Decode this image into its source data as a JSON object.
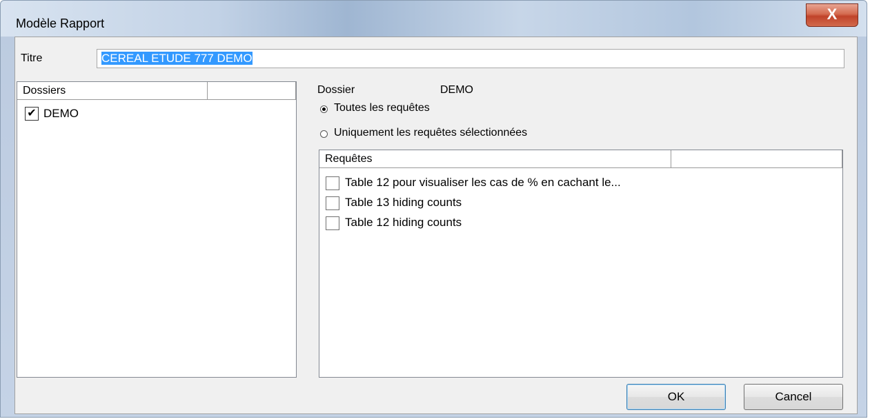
{
  "window": {
    "title": "Modèle Rapport",
    "close_glyph": "X"
  },
  "titre": {
    "label": "Titre",
    "value": "CEREAL ETUDE 777 DEMO"
  },
  "dossiers": {
    "header": "Dossiers",
    "items": [
      {
        "label": "DEMO",
        "checked": true
      }
    ]
  },
  "dossier_info": {
    "label": "Dossier",
    "value": "DEMO"
  },
  "radios": [
    {
      "label": "Toutes les requêtes",
      "checked": true
    },
    {
      "label": "Uniquement les requêtes sélectionnées",
      "checked": false
    }
  ],
  "requetes": {
    "header": "Requêtes",
    "items": [
      {
        "label": "Table 12 pour visualiser les cas de % en cachant le...",
        "checked": false
      },
      {
        "label": "Table 13 hiding counts",
        "checked": false
      },
      {
        "label": "Table 12  hiding counts",
        "checked": false
      }
    ]
  },
  "buttons": {
    "ok": "OK",
    "cancel": "Cancel"
  },
  "icons": {
    "check": "checkmark-icon",
    "close": "close-icon"
  }
}
